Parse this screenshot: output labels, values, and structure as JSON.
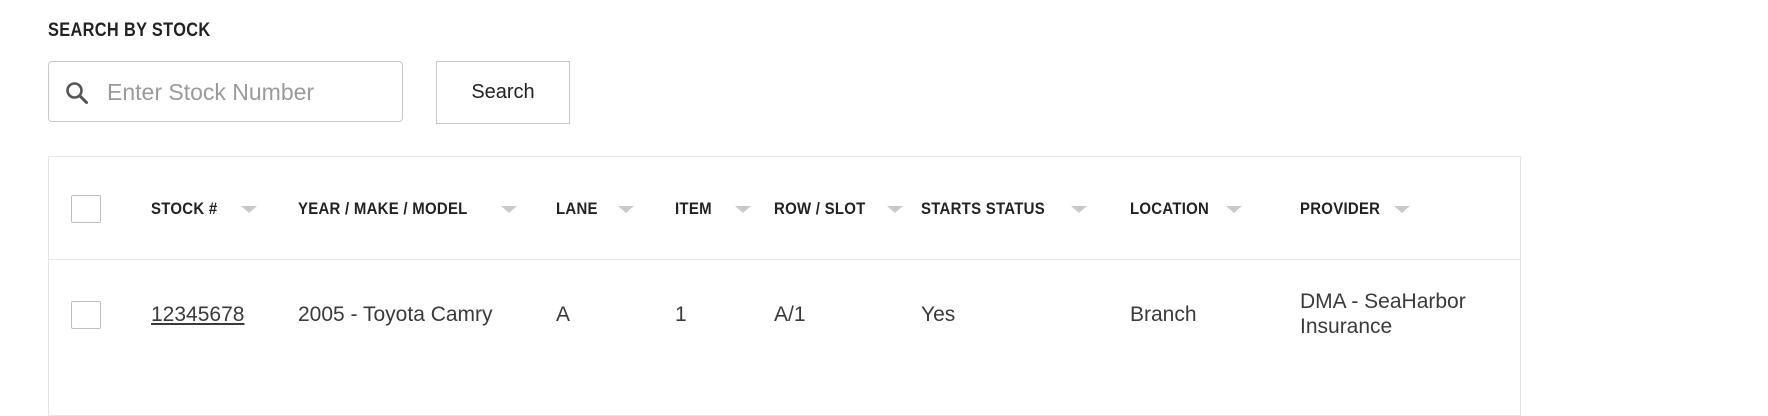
{
  "search": {
    "heading": "SEARCH BY STOCK",
    "placeholder": "Enter Stock Number",
    "value": "",
    "button_label": "Search",
    "icon": "search-icon"
  },
  "table": {
    "columns": [
      {
        "key": "stock",
        "label": "STOCK #",
        "sortable": true
      },
      {
        "key": "ymm",
        "label": "YEAR / MAKE / MODEL",
        "sortable": true
      },
      {
        "key": "lane",
        "label": "LANE",
        "sortable": true
      },
      {
        "key": "item",
        "label": "ITEM",
        "sortable": true
      },
      {
        "key": "row_slot",
        "label": "ROW / SLOT",
        "sortable": true
      },
      {
        "key": "starts_status",
        "label": "STARTS STATUS",
        "sortable": true
      },
      {
        "key": "location",
        "label": "LOCATION",
        "sortable": true
      },
      {
        "key": "provider",
        "label": "PROVIDER",
        "sortable": true
      }
    ],
    "rows": [
      {
        "stock": "12345678",
        "ymm": "2005 - Toyota Camry",
        "lane": "A",
        "item": "1",
        "row_slot": "A/1",
        "starts_status": "Yes",
        "location": "Branch",
        "provider": "DMA - SeaHarbor Insurance",
        "selected": false
      }
    ],
    "select_all": false
  },
  "colors": {
    "border": "#c8c8c8",
    "table_border": "#e6e6e6",
    "caret": "#c9c9c9",
    "text": "#3a3a3a",
    "heading": "#222222"
  }
}
